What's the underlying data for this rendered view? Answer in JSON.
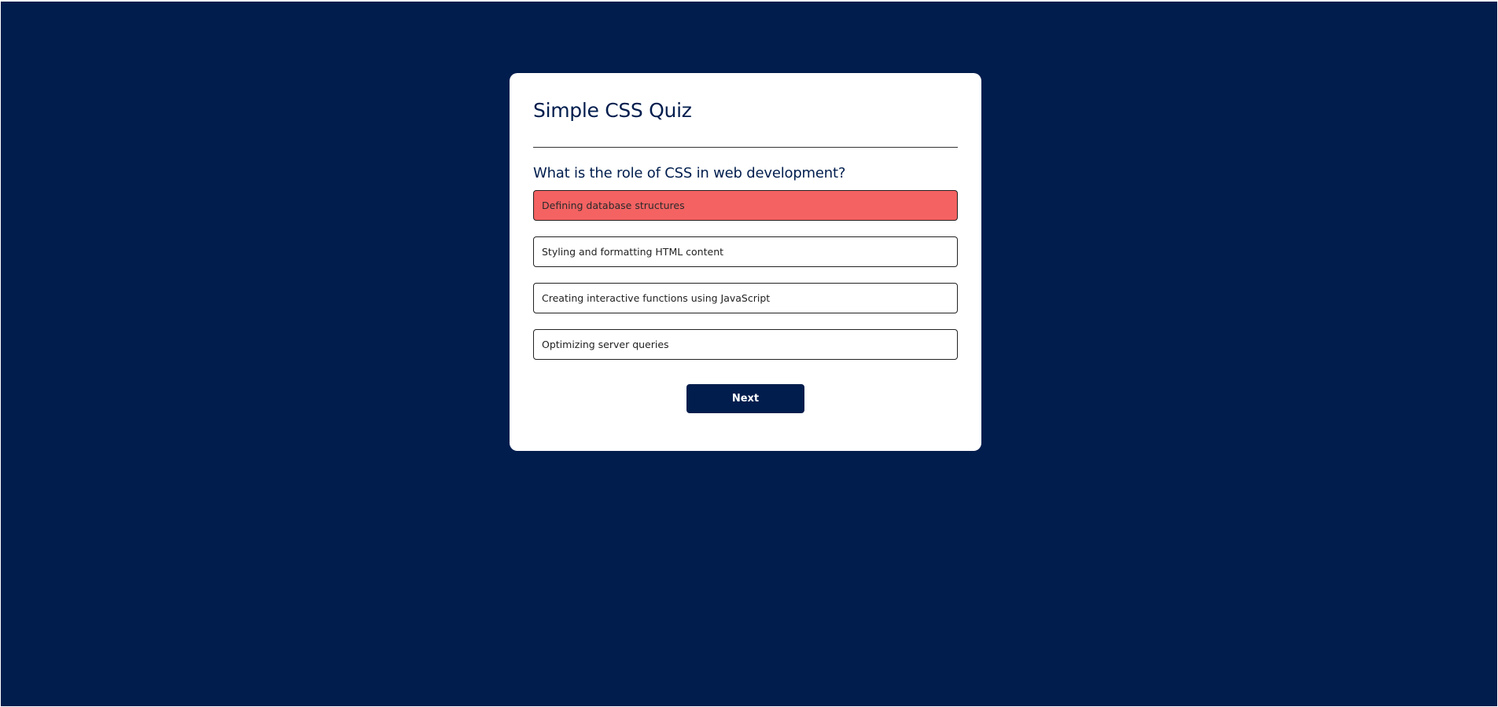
{
  "quiz": {
    "title": "Simple CSS Quiz",
    "question": "What is the role of CSS in web development?",
    "answers": [
      {
        "label": "Defining database structures",
        "state": "incorrect"
      },
      {
        "label": "Styling and formatting HTML content",
        "state": "default"
      },
      {
        "label": "Creating interactive functions using JavaScript",
        "state": "default"
      },
      {
        "label": "Optimizing server queries",
        "state": "default"
      }
    ],
    "next_label": "Next"
  },
  "colors": {
    "background": "#001d4d",
    "card": "#ffffff",
    "incorrect": "#f46262",
    "accent": "#001d4d"
  }
}
